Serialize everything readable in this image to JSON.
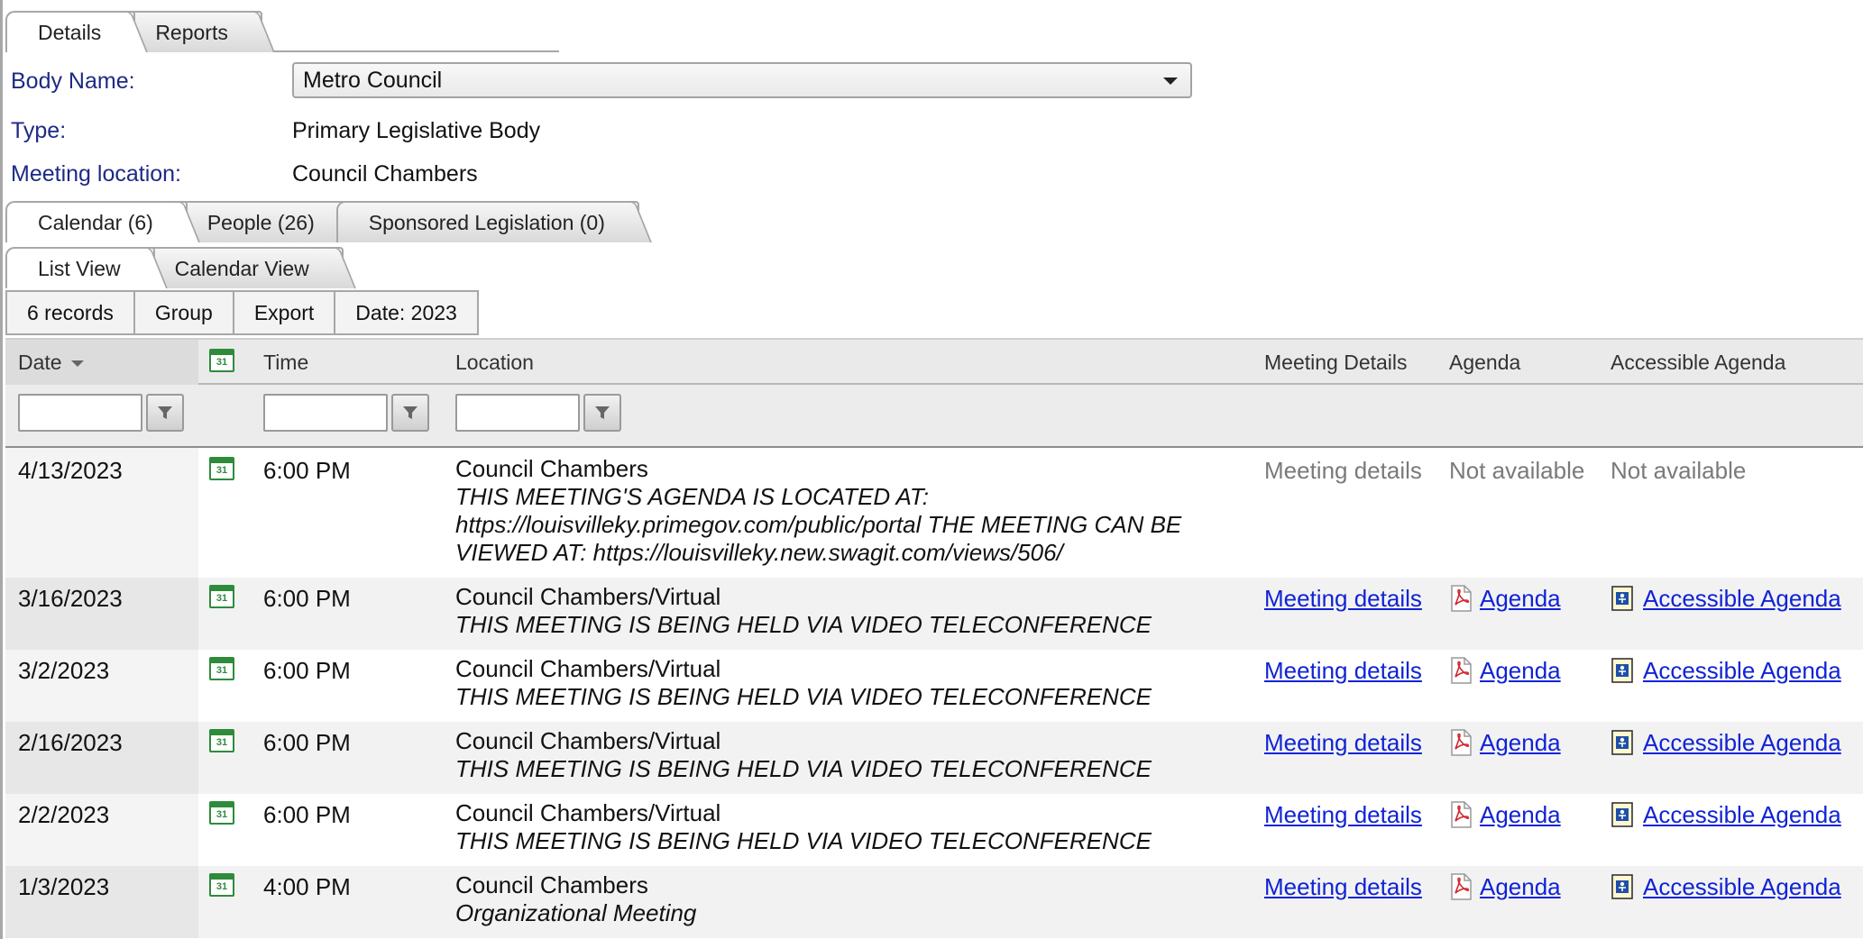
{
  "top_tabs": [
    {
      "label": "Details",
      "active": true
    },
    {
      "label": "Reports",
      "active": false
    }
  ],
  "form": {
    "body_name_label": "Body Name:",
    "body_name_value": "Metro Council",
    "type_label": "Type:",
    "type_value": "Primary Legislative Body",
    "location_label": "Meeting location:",
    "location_value": "Council Chambers"
  },
  "section_tabs": [
    {
      "label": "Calendar (6)",
      "active": true
    },
    {
      "label": "People (26)",
      "active": false
    },
    {
      "label": "Sponsored Legislation (0)",
      "active": false
    }
  ],
  "view_tabs": [
    {
      "label": "List View",
      "active": true
    },
    {
      "label": "Calendar View",
      "active": false
    }
  ],
  "toolbar": {
    "records": "6 records",
    "group": "Group",
    "export": "Export",
    "date": "Date: 2023"
  },
  "columns": {
    "date": "Date",
    "time": "Time",
    "location": "Location",
    "meeting_details": "Meeting Details",
    "agenda": "Agenda",
    "accessible_agenda": "Accessible Agenda"
  },
  "calendar_icon_text": "31",
  "rows": [
    {
      "date": "4/13/2023",
      "time": "6:00 PM",
      "location": "Council Chambers",
      "note_lines": [
        "THIS MEETING'S AGENDA IS LOCATED AT:",
        "https://louisvilleky.primegov.com/public/portal THE MEETING CAN BE",
        "VIEWED AT: https://louisvilleky.new.swagit.com/views/506/"
      ],
      "meeting_details": "Meeting details",
      "agenda": "Not available",
      "accessible_agenda": "Not available",
      "available": false
    },
    {
      "date": "3/16/2023",
      "time": "6:00 PM",
      "location": "Council Chambers/Virtual",
      "note_lines": [
        "THIS MEETING IS BEING HELD VIA VIDEO TELECONFERENCE"
      ],
      "meeting_details": "Meeting details",
      "agenda": "Agenda",
      "accessible_agenda": "Accessible Agenda",
      "available": true
    },
    {
      "date": "3/2/2023",
      "time": "6:00 PM",
      "location": "Council Chambers/Virtual",
      "note_lines": [
        "THIS MEETING IS BEING HELD VIA VIDEO TELECONFERENCE"
      ],
      "meeting_details": "Meeting details",
      "agenda": "Agenda",
      "accessible_agenda": "Accessible Agenda",
      "available": true
    },
    {
      "date": "2/16/2023",
      "time": "6:00 PM",
      "location": "Council Chambers/Virtual",
      "note_lines": [
        "THIS MEETING IS BEING HELD VIA VIDEO TELECONFERENCE"
      ],
      "meeting_details": "Meeting details",
      "agenda": "Agenda",
      "accessible_agenda": "Accessible Agenda",
      "available": true
    },
    {
      "date": "2/2/2023",
      "time": "6:00 PM",
      "location": "Council Chambers/Virtual",
      "note_lines": [
        "THIS MEETING IS BEING HELD VIA VIDEO TELECONFERENCE"
      ],
      "meeting_details": "Meeting details",
      "agenda": "Agenda",
      "accessible_agenda": "Accessible Agenda",
      "available": true
    },
    {
      "date": "1/3/2023",
      "time": "4:00 PM",
      "location": "Council Chambers",
      "note_lines": [
        "Organizational Meeting"
      ],
      "meeting_details": "Meeting details",
      "agenda": "Agenda",
      "accessible_agenda": "Accessible Agenda",
      "available": true
    }
  ],
  "icons": {
    "calendar": "calendar-icon",
    "pdf": "pdf-icon",
    "accessible_doc": "accessible-document-icon",
    "filter": "filter-icon",
    "dropdown": "chevron-down-icon",
    "sort": "sort-descending-icon"
  },
  "colors": {
    "label_blue": "#1e2a85",
    "link_blue": "#1023d6",
    "calendar_green": "#2e8b3a",
    "unavailable_grey": "#7a7a7a"
  }
}
